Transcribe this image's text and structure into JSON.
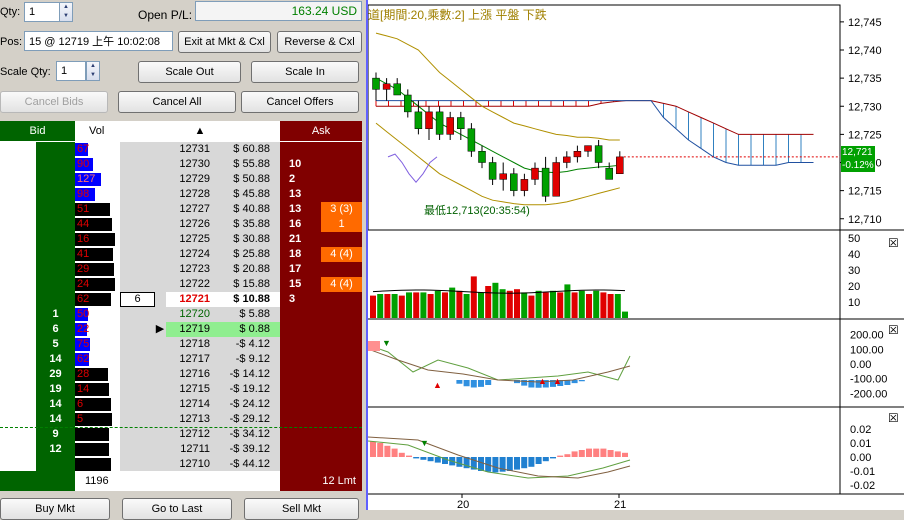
{
  "controls": {
    "qty_label": "Qty:",
    "qty_value": "1",
    "open_pl_label": "Open P/L:",
    "open_pl_value": "163.24 USD",
    "pos_label": "Pos:",
    "pos_value": "15 @ 12719 上午 10:02:08",
    "exit_button": "Exit at Mkt & Cxl",
    "reverse_button": "Reverse & Cxl",
    "scale_qty_label": "Scale Qty:",
    "scale_qty_value": "1",
    "scale_out_button": "Scale Out",
    "scale_in_button": "Scale In",
    "cancel_bids_button": "Cancel Bids",
    "cancel_all_button": "Cancel All",
    "cancel_offers_button": "Cancel Offers"
  },
  "ladder": {
    "headers": {
      "bid": "Bid",
      "vol": "Vol",
      "ask": "Ask"
    },
    "rows": [
      {
        "bid": "",
        "vol": "67",
        "vol_bar": 0.32,
        "price": "12731",
        "pl": "$ 60.88",
        "ask": "",
        "order": ""
      },
      {
        "bid": "",
        "vol": "90",
        "vol_bar": 0.43,
        "price": "12730",
        "pl": "$ 55.88",
        "ask": "10",
        "order": ""
      },
      {
        "bid": "",
        "vol": "127",
        "vol_bar": 0.62,
        "price": "12729",
        "pl": "$ 50.88",
        "ask": "2",
        "order": ""
      },
      {
        "bid": "",
        "vol": "98",
        "vol_bar": 0.47,
        "price": "12728",
        "pl": "$ 45.88",
        "ask": "13",
        "order": ""
      },
      {
        "bid": "",
        "vol": "51",
        "vol_bar": 0.83,
        "price": "12727",
        "pl": "$ 40.88",
        "ask": "13",
        "order": "3 (3)"
      },
      {
        "bid": "",
        "vol": "44",
        "vol_bar": 0.87,
        "price": "12726",
        "pl": "$ 35.88",
        "ask": "16",
        "order": "1"
      },
      {
        "bid": "",
        "vol": "16",
        "vol_bar": 0.96,
        "price": "12725",
        "pl": "$ 30.88",
        "ask": "21",
        "order": ""
      },
      {
        "bid": "",
        "vol": "41",
        "vol_bar": 0.9,
        "price": "12724",
        "pl": "$ 25.88",
        "ask": "18",
        "order": "4 (4)"
      },
      {
        "bid": "",
        "vol": "29",
        "vol_bar": 0.94,
        "price": "12723",
        "pl": "$ 20.88",
        "ask": "17",
        "order": ""
      },
      {
        "bid": "",
        "vol": "24",
        "vol_bar": 0.95,
        "price": "12722",
        "pl": "$ 15.88",
        "ask": "15",
        "order": "4 (4)"
      },
      {
        "bid": "",
        "vol": "62",
        "vol_bar": 0.85,
        "price": "12721",
        "pl": "$ 10.88",
        "ask": "3",
        "order": "",
        "last": "6",
        "current": true
      },
      {
        "bid": "1",
        "vol": "50",
        "vol_bar": 0.3,
        "price": "12720",
        "pl": "$ 5.88",
        "ask": "",
        "order": ""
      },
      {
        "bid": "6",
        "vol": "22",
        "vol_bar": 0.28,
        "price": "12719",
        "pl": "$ 0.88",
        "ask": "",
        "order": "",
        "entry": true
      },
      {
        "bid": "5",
        "vol": "75",
        "vol_bar": 0.36,
        "price": "12718",
        "pl": "-$ 4.12",
        "ask": "",
        "order": ""
      },
      {
        "bid": "14",
        "vol": "62",
        "vol_bar": 0.33,
        "price": "12717",
        "pl": "-$ 9.12",
        "ask": "",
        "order": ""
      },
      {
        "bid": "29",
        "vol": "28",
        "vol_bar": 0.78,
        "price": "12716",
        "pl": "-$ 14.12",
        "ask": "",
        "order": ""
      },
      {
        "bid": "19",
        "vol": "14",
        "vol_bar": 0.82,
        "price": "12715",
        "pl": "-$ 19.12",
        "ask": "",
        "order": ""
      },
      {
        "bid": "14",
        "vol": "6",
        "vol_bar": 0.86,
        "price": "12714",
        "pl": "-$ 24.12",
        "ask": "",
        "order": ""
      },
      {
        "bid": "14",
        "vol": "5",
        "vol_bar": 0.88,
        "price": "12713",
        "pl": "-$ 29.12",
        "ask": "",
        "order": ""
      },
      {
        "bid": "9",
        "vol": "",
        "vol_bar": 0.8,
        "price": "12712",
        "pl": "-$ 34.12",
        "ask": "",
        "order": ""
      },
      {
        "bid": "12",
        "vol": "",
        "vol_bar": 0.82,
        "price": "12711",
        "pl": "-$ 39.12",
        "ask": "",
        "order": ""
      },
      {
        "bid": "",
        "vol": "",
        "vol_bar": 0.85,
        "price": "12710",
        "pl": "-$ 44.12",
        "ask": "",
        "order": ""
      }
    ],
    "footer_vol": "1196",
    "footer_lmt": "12 Lmt"
  },
  "bottom_buttons": {
    "buy_mkt": "Buy Mkt",
    "go_to_last": "Go to Last",
    "sell_mkt": "Sell Mkt"
  },
  "chart": {
    "title": "道[期間:20,乘數:2] 上漲  平盤  下跌",
    "annotation": "最低12,713(20:35:54)",
    "current_price": "12,721",
    "current_change": "-0.12%",
    "price_axis": [
      "12,745",
      "12,740",
      "12,735",
      "12,730",
      "12,725",
      "12,720",
      "12,715",
      "12,710"
    ],
    "volume_axis": [
      "50",
      "40",
      "30",
      "20",
      "10"
    ],
    "osc1_axis": [
      "200.00",
      "100.00",
      "0.00",
      "-100.00",
      "-200.00"
    ],
    "osc2_axis": [
      "0.02",
      "0.01",
      "0.00",
      "-0.01",
      "-0.02"
    ],
    "x_ticks": [
      "20",
      "21"
    ],
    "close_glyph": "☒",
    "colors": {
      "up": "#e00000",
      "down": "#00a000",
      "accent": "#3060ff"
    }
  },
  "chart_data": {
    "type": "candlestick",
    "ylim": [
      12708,
      12748
    ],
    "candles": [
      {
        "o": 12735,
        "h": 12736,
        "l": 12731,
        "c": 12733
      },
      {
        "o": 12733,
        "h": 12735,
        "l": 12731,
        "c": 12734
      },
      {
        "o": 12734,
        "h": 12735,
        "l": 12732,
        "c": 12732
      },
      {
        "o": 12732,
        "h": 12733,
        "l": 12728,
        "c": 12729
      },
      {
        "o": 12729,
        "h": 12731,
        "l": 12725,
        "c": 12726
      },
      {
        "o": 12726,
        "h": 12730,
        "l": 12724,
        "c": 12729
      },
      {
        "o": 12729,
        "h": 12730,
        "l": 12724,
        "c": 12725
      },
      {
        "o": 12725,
        "h": 12729,
        "l": 12724,
        "c": 12728
      },
      {
        "o": 12728,
        "h": 12729,
        "l": 12724,
        "c": 12726
      },
      {
        "o": 12726,
        "h": 12727,
        "l": 12721,
        "c": 12722
      },
      {
        "o": 12722,
        "h": 12723,
        "l": 12719,
        "c": 12720
      },
      {
        "o": 12720,
        "h": 12721,
        "l": 12716,
        "c": 12717
      },
      {
        "o": 12717,
        "h": 12720,
        "l": 12715,
        "c": 12718
      },
      {
        "o": 12718,
        "h": 12719,
        "l": 12714,
        "c": 12715
      },
      {
        "o": 12715,
        "h": 12718,
        "l": 12714,
        "c": 12717
      },
      {
        "o": 12717,
        "h": 12720,
        "l": 12716,
        "c": 12719
      },
      {
        "o": 12719,
        "h": 12721,
        "l": 12713,
        "c": 12714
      },
      {
        "o": 12714,
        "h": 12721,
        "l": 12714,
        "c": 12720
      },
      {
        "o": 12720,
        "h": 12722,
        "l": 12719,
        "c": 12721
      },
      {
        "o": 12721,
        "h": 12723,
        "l": 12720,
        "c": 12722
      },
      {
        "o": 12722,
        "h": 12723,
        "l": 12721,
        "c": 12723
      },
      {
        "o": 12723,
        "h": 12724,
        "l": 12719,
        "c": 12720
      },
      {
        "o": 12719,
        "h": 12720,
        "l": 12717,
        "c": 12717
      },
      {
        "o": 12718,
        "h": 12722,
        "l": 12718,
        "c": 12721
      }
    ],
    "upper_band": [
      12743,
      12742.5,
      12742,
      12741,
      12740,
      12738,
      12736,
      12734.5,
      12733,
      12731.5,
      12730,
      12729,
      12728,
      12727,
      12726.5,
      12726,
      12725.5,
      12725,
      12724.8,
      12724.5,
      12724.5,
      12724.3,
      12724,
      12724
    ],
    "lower_band": [
      12727,
      12725.5,
      12724,
      12722.5,
      12721,
      12719.5,
      12718,
      12717,
      12716,
      12715,
      12714,
      12713.3,
      12713,
      12712.7,
      12712.5,
      12712.5,
      12712.5,
      12712.7,
      12713,
      12713.5,
      12714,
      12714.5,
      12715,
      12715.5
    ],
    "ma": [
      12735,
      12734,
      12733,
      12731.5,
      12730,
      12728.5,
      12727,
      12726,
      12725,
      12724,
      12723,
      12722,
      12721,
      12720,
      12719,
      12718.5,
      12718.3,
      12718.2,
      12718.4,
      12718.8,
      12719,
      12719.2,
      12719.3,
      12719.5
    ],
    "cloud_top": [
      12730,
      12730,
      12730,
      12730,
      12730,
      12730,
      12730,
      12730,
      12730,
      12730,
      12730,
      12730,
      12730,
      12730,
      12730,
      12730,
      12730,
      12730,
      12730.5,
      12730.8,
      12731,
      12731,
      12731,
      12730.5,
      12730,
      12729,
      12728,
      12727,
      12726,
      12725,
      12725,
      12725,
      12725,
      12725,
      12725,
      12725
    ],
    "cloud_bottom": [
      12731,
      12731,
      12731,
      12731,
      12731,
      12731,
      12731,
      12731,
      12731,
      12731,
      12731,
      12731,
      12731,
      12731,
      12731,
      12731,
      12731,
      12731,
      12731,
      12731,
      12731,
      12731,
      12731,
      12728,
      12726,
      12724,
      12722.5,
      12721,
      12720,
      12719.5,
      12719.5,
      12719.5,
      12719.5,
      12720,
      12720,
      12720
    ],
    "lagging_line": [
      12721,
      12721.5,
      12720,
      12718,
      12716.5,
      12718,
      12720,
      12721
    ],
    "volume": [
      14,
      15,
      15,
      15,
      14,
      16,
      16,
      16,
      15,
      17,
      16,
      19,
      17,
      15,
      26,
      16,
      20,
      22,
      18,
      17,
      18,
      16,
      14,
      17,
      16,
      17,
      16,
      21,
      16,
      17,
      15,
      17,
      16,
      15,
      15,
      4
    ],
    "volume_up": [
      true,
      false,
      true,
      false,
      true,
      false,
      true,
      false,
      true,
      false,
      true,
      false,
      true,
      false,
      true,
      false,
      true,
      false,
      false,
      true,
      true,
      false,
      true,
      false,
      true,
      false,
      true,
      false,
      true,
      false,
      true,
      false,
      true,
      true,
      false,
      false
    ],
    "osc1_hist": [
      0,
      0,
      0,
      0,
      0,
      0,
      0,
      0,
      0,
      0,
      0,
      0,
      -30,
      -50,
      -60,
      -55,
      -40,
      0,
      0,
      0,
      -25,
      -45,
      -60,
      -62,
      -60,
      -55,
      -48,
      -40,
      -25,
      -10,
      0,
      0,
      0,
      0,
      0,
      0
    ],
    "osc2_hist": [
      0.011,
      0.01,
      0.008,
      0.006,
      0.003,
      0.001,
      -0.001,
      -0.002,
      -0.003,
      -0.004,
      -0.005,
      -0.006,
      -0.007,
      -0.008,
      -0.009,
      -0.01,
      -0.0105,
      -0.011,
      -0.0105,
      -0.01,
      -0.009,
      -0.008,
      -0.007,
      -0.005,
      -0.003,
      -0.001,
      0.001,
      0.002,
      0.004,
      0.005,
      0.006,
      0.006,
      0.006,
      0.005,
      0.004,
      0.003
    ],
    "x_ticks": [
      "20",
      "21"
    ]
  }
}
